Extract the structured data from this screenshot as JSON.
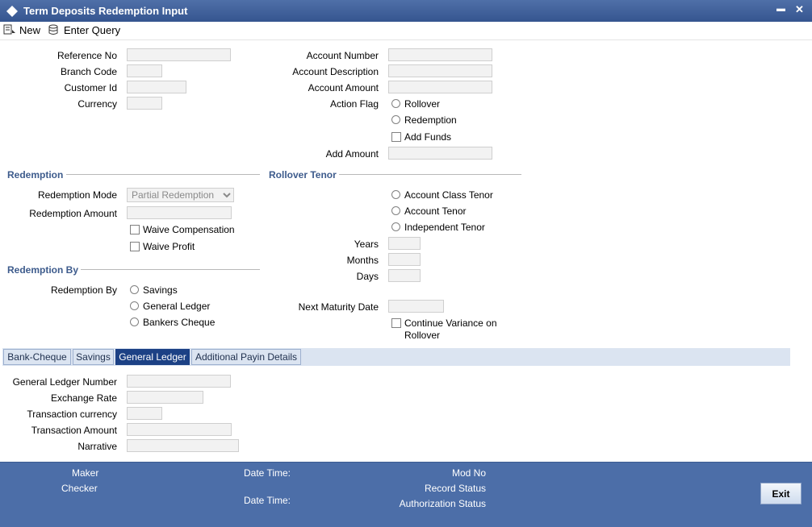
{
  "window": {
    "title": "Term Deposits Redemption Input",
    "minimize_glyph": "▬",
    "close_glyph": "✕"
  },
  "toolbar": {
    "new_label": "New",
    "enter_query_label": "Enter Query"
  },
  "header_fields": {
    "reference_no": "Reference No",
    "branch_code": "Branch Code",
    "customer_id": "Customer Id",
    "currency": "Currency",
    "account_number": "Account Number",
    "account_description": "Account Description",
    "account_amount": "Account Amount",
    "action_flag": "Action Flag",
    "rollover": "Rollover",
    "redemption": "Redemption",
    "add_funds": "Add Funds",
    "add_amount": "Add Amount"
  },
  "redemption": {
    "section_title": "Redemption",
    "mode_label": "Redemption Mode",
    "mode_value": "Partial Redemption",
    "amount_label": "Redemption Amount",
    "waive_compensation": "Waive Compensation",
    "waive_profit": "Waive Profit"
  },
  "rollover_tenor": {
    "section_title": "Rollover Tenor",
    "account_class_tenor": "Account Class Tenor",
    "account_tenor": "Account Tenor",
    "independent_tenor": "Independent Tenor",
    "years": "Years",
    "months": "Months",
    "days": "Days",
    "next_maturity_date": "Next Maturity Date",
    "continue_variance_line1": "Continue Variance on",
    "continue_variance_line2": "Rollover"
  },
  "redemption_by": {
    "section_title": "Redemption By",
    "label": "Redemption By",
    "savings": "Savings",
    "general_ledger": "General Ledger",
    "bankers_cheque": "Bankers Cheque"
  },
  "tabs": [
    {
      "label": "Bank-Cheque"
    },
    {
      "label": "Savings"
    },
    {
      "label": "General Ledger"
    },
    {
      "label": "Additional Payin Details"
    }
  ],
  "gl_tab": {
    "gl_number": "General Ledger Number",
    "exchange_rate": "Exchange Rate",
    "txn_currency": "Transaction currency",
    "txn_amount": "Transaction Amount",
    "narrative": "Narrative"
  },
  "footer": {
    "maker": "Maker",
    "checker": "Checker",
    "date_time_1": "Date Time:",
    "date_time_2": "Date Time:",
    "mod_no": "Mod No",
    "record_status": "Record Status",
    "authorization_status": "Authorization Status",
    "exit_label": "Exit"
  },
  "colors": {
    "titlebar": "#3d5e98",
    "section_title": "#3d5b8c",
    "active_tab": "#1c4185",
    "footer": "#4c6ea8"
  }
}
